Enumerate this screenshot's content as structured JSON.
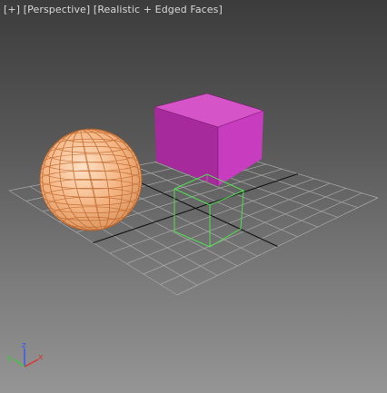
{
  "viewport": {
    "label_plus": "[+]",
    "label_view": "[Perspective]",
    "label_shading": "[Realistic + Edged Faces]"
  },
  "objects": [
    {
      "name": "Sphere",
      "type": "sphere",
      "color": "#f0b080",
      "wire_color": "#c06a30"
    },
    {
      "name": "Box",
      "type": "box",
      "color": "#c83cc0",
      "selected": false
    },
    {
      "name": "Box",
      "type": "box",
      "color": "#50e050",
      "selected": true,
      "display": "wireframe"
    }
  ],
  "grid": {
    "color": "#a8a8a8",
    "axis_color": "#101010"
  },
  "axis_tripod": {
    "z": "z",
    "y": "y",
    "x": "x",
    "z_color": "#3050ff",
    "y_color": "#30d030",
    "x_color": "#e03030"
  }
}
